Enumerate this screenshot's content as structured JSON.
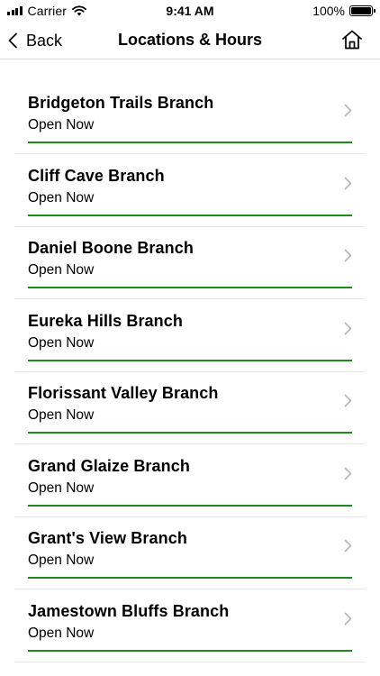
{
  "status_bar": {
    "carrier": "Carrier",
    "time": "9:41 AM",
    "battery": "100%"
  },
  "nav": {
    "back_label": "Back",
    "title": "Locations & Hours"
  },
  "colors": {
    "open_underline": "#1f8a1f",
    "chevron": "#b5b5b5"
  },
  "branches": [
    {
      "name": "Bridgeton Trails Branch",
      "status": "Open Now"
    },
    {
      "name": "Cliff Cave Branch",
      "status": "Open Now"
    },
    {
      "name": "Daniel Boone Branch",
      "status": "Open Now"
    },
    {
      "name": "Eureka Hills Branch",
      "status": "Open Now"
    },
    {
      "name": "Florissant Valley Branch",
      "status": "Open Now"
    },
    {
      "name": "Grand Glaize Branch",
      "status": "Open Now"
    },
    {
      "name": "Grant's View Branch",
      "status": "Open Now"
    },
    {
      "name": "Jamestown Bluffs Branch",
      "status": "Open Now"
    }
  ]
}
